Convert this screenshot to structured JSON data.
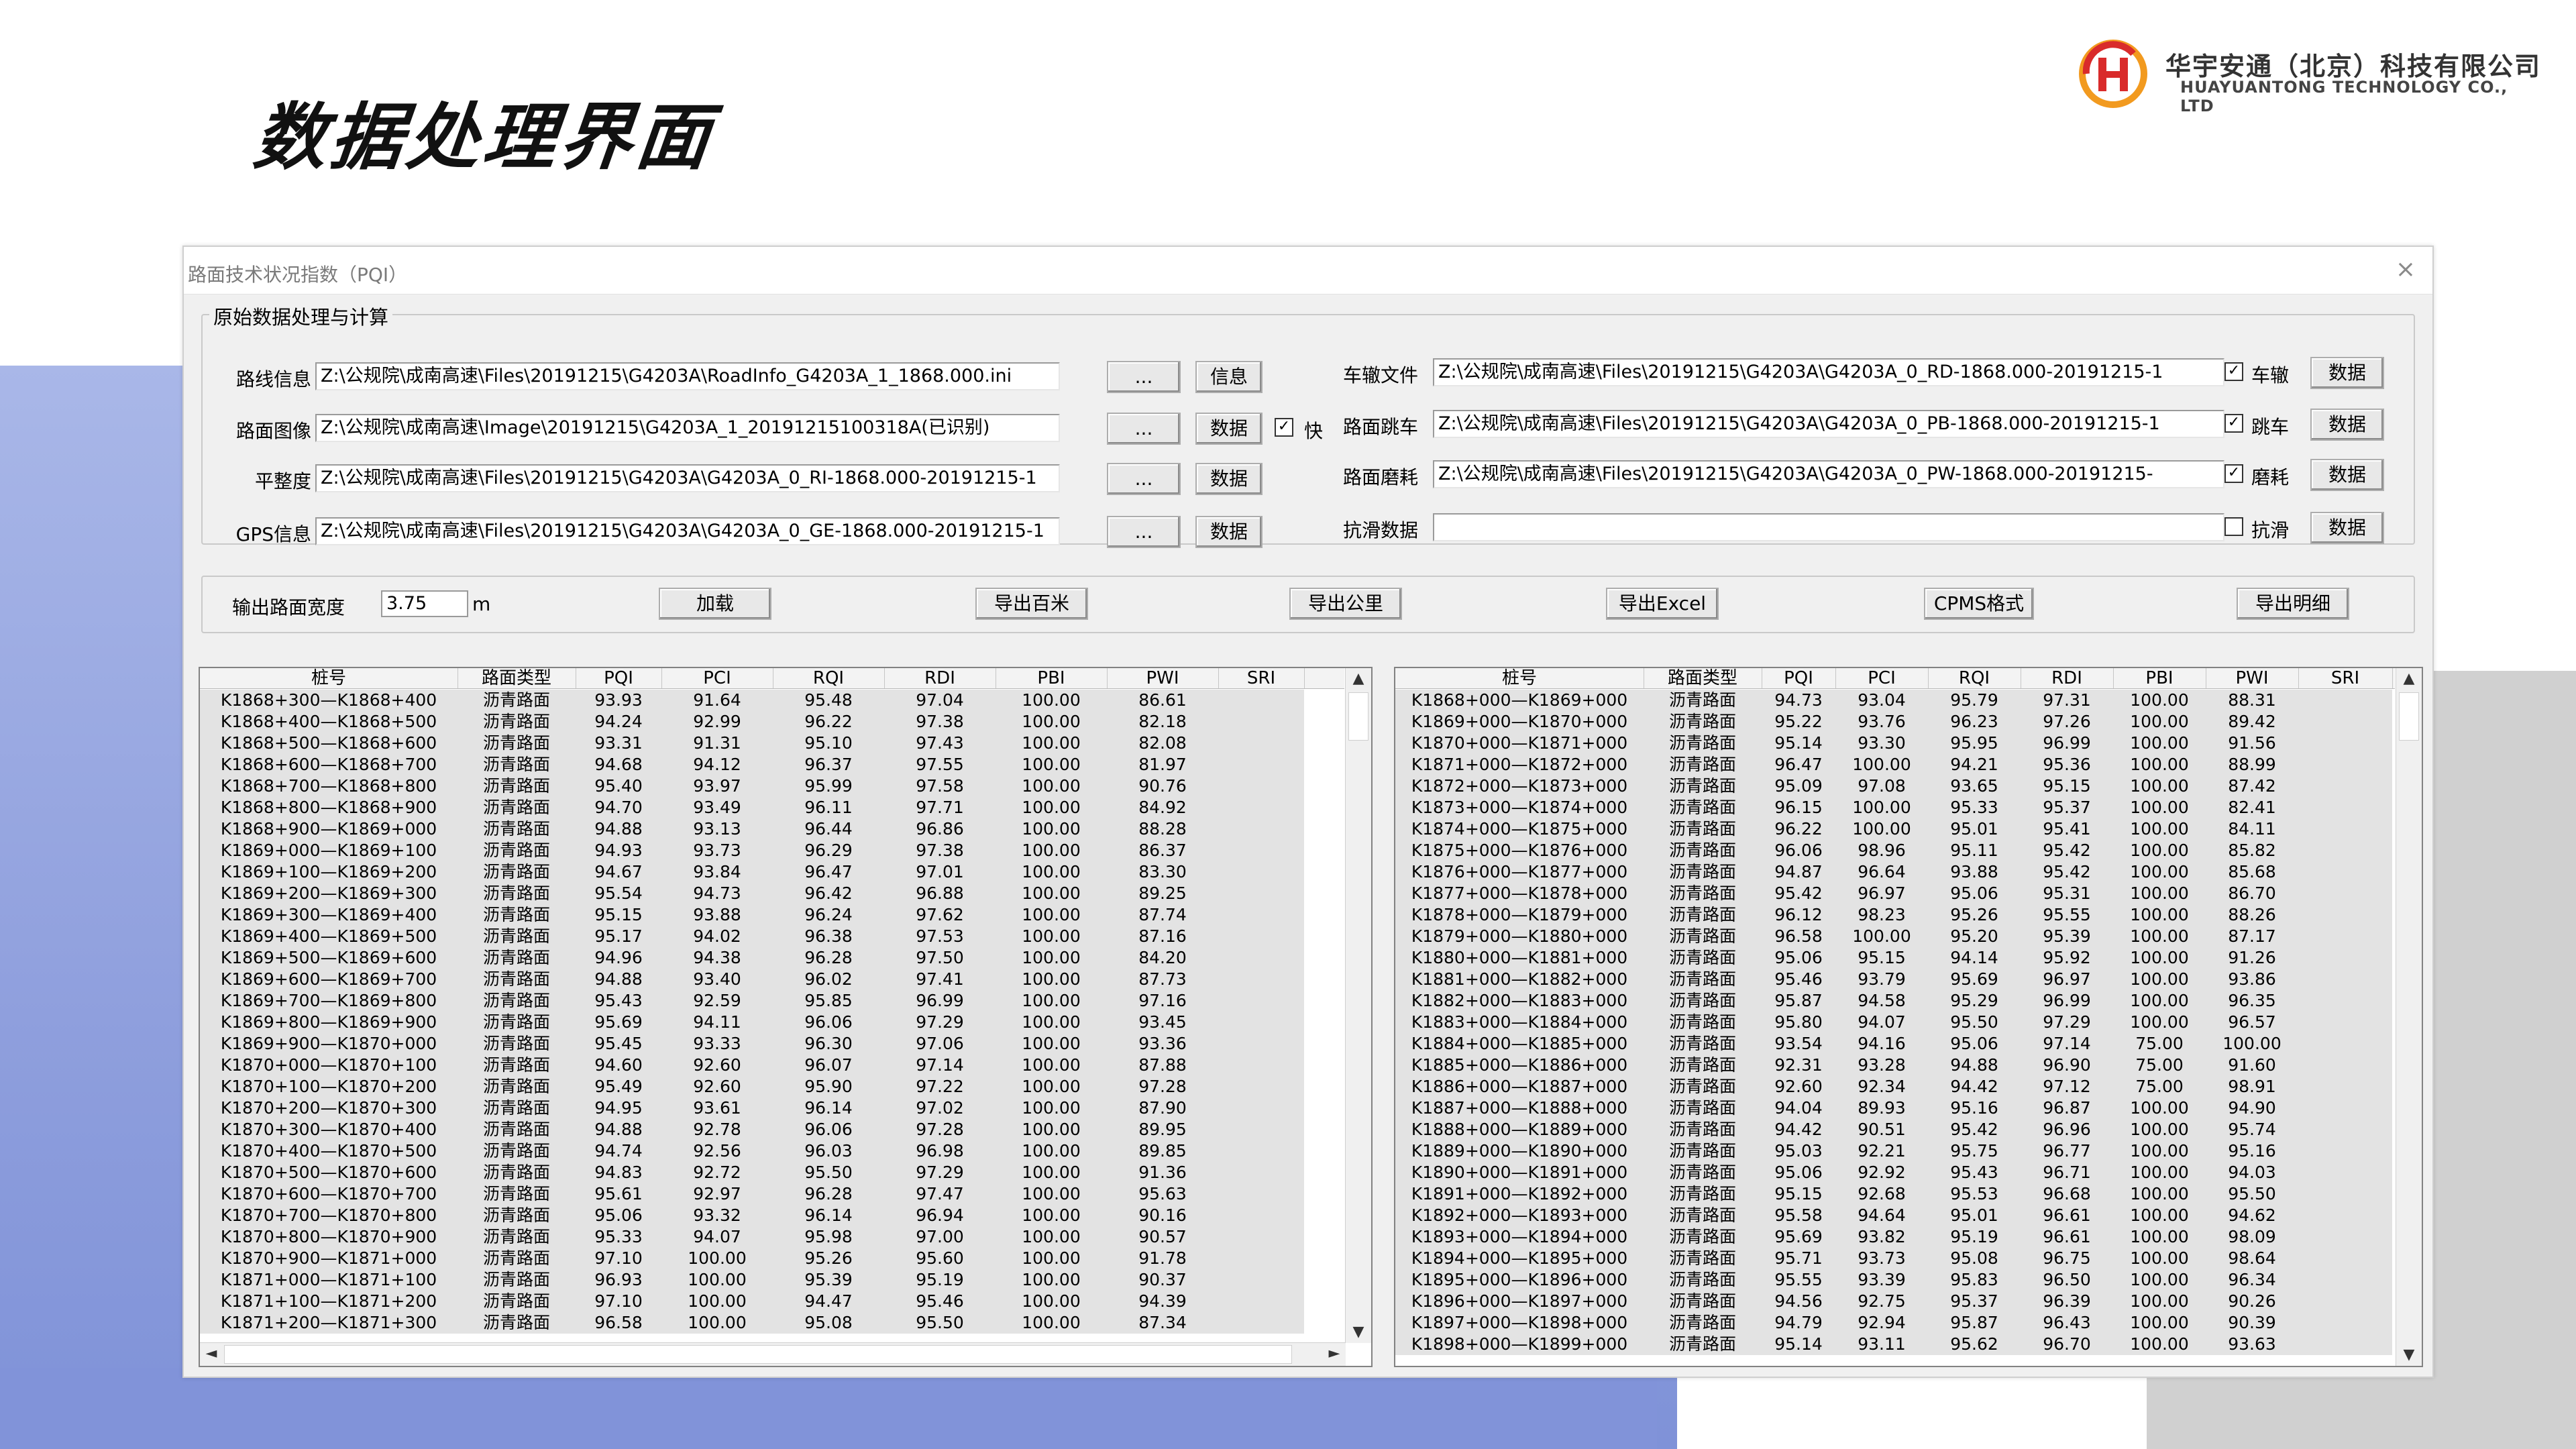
{
  "slide": {
    "title": "数据处理界面",
    "logo_cn": "华宇安通（北京）科技有限公司",
    "logo_en": "HUAYUANTONG TECHNOLOGY CO., LTD",
    "accent_red": "#d92b2b",
    "accent_orange": "#f29a1f"
  },
  "window": {
    "title": "路面技术状况指数（PQI）",
    "close_icon": "×",
    "group_title": "原始数据处理与计算"
  },
  "left_fields": [
    {
      "label": "路线信息",
      "value": "Z:\\公规院\\成南高速\\Files\\20191215\\G4203A\\RoadInfo_G4203A_1_1868.000.ini",
      "browse": "...",
      "action": "信息"
    },
    {
      "label": "路面图像",
      "value": "Z:\\公规院\\成南高速\\Image\\20191215\\G4203A_1_20191215100318A(已识别)",
      "browse": "...",
      "action": "数据",
      "check_label": "快",
      "checked": "✓"
    },
    {
      "label": "平整度",
      "value": "Z:\\公规院\\成南高速\\Files\\20191215\\G4203A\\G4203A_0_RI-1868.000-20191215-1",
      "browse": "...",
      "action": "数据"
    },
    {
      "label": "GPS信息",
      "value": "Z:\\公规院\\成南高速\\Files\\20191215\\G4203A\\G4203A_0_GE-1868.000-20191215-1",
      "browse": "...",
      "action": "数据"
    }
  ],
  "right_fields": [
    {
      "label": "车辙文件",
      "value": "Z:\\公规院\\成南高速\\Files\\20191215\\G4203A\\G4203A_0_RD-1868.000-20191215-1",
      "check_label": "车辙",
      "checked": "✓",
      "action": "数据"
    },
    {
      "label": "路面跳车",
      "value": "Z:\\公规院\\成南高速\\Files\\20191215\\G4203A\\G4203A_0_PB-1868.000-20191215-1",
      "check_label": "跳车",
      "checked": "✓",
      "action": "数据"
    },
    {
      "label": "路面磨耗",
      "value": "Z:\\公规院\\成南高速\\Files\\20191215\\G4203A\\G4203A_0_PW-1868.000-20191215-",
      "check_label": "磨耗",
      "checked": "✓",
      "action": "数据"
    },
    {
      "label": "抗滑数据",
      "value": "",
      "check_label": "抗滑",
      "checked": "",
      "action": "数据"
    }
  ],
  "output": {
    "width_label": "输出路面宽度",
    "width_value": "3.75",
    "unit": "m",
    "buttons": [
      "加载",
      "导出百米",
      "导出公里",
      "导出Excel",
      "CPMS格式",
      "导出明细"
    ]
  },
  "columns": [
    "桩号",
    "路面类型",
    "PQI",
    "PCI",
    "RQI",
    "RDI",
    "PBI",
    "PWI",
    "SRI"
  ],
  "left_table": [
    [
      "K1868+300—K1868+400",
      "沥青路面",
      "93.93",
      "91.64",
      "95.48",
      "97.04",
      "100.00",
      "86.61",
      ""
    ],
    [
      "K1868+400—K1868+500",
      "沥青路面",
      "94.24",
      "92.99",
      "96.22",
      "97.38",
      "100.00",
      "82.18",
      ""
    ],
    [
      "K1868+500—K1868+600",
      "沥青路面",
      "93.31",
      "91.31",
      "95.10",
      "97.43",
      "100.00",
      "82.08",
      ""
    ],
    [
      "K1868+600—K1868+700",
      "沥青路面",
      "94.68",
      "94.12",
      "96.37",
      "97.55",
      "100.00",
      "81.97",
      ""
    ],
    [
      "K1868+700—K1868+800",
      "沥青路面",
      "95.40",
      "93.97",
      "95.99",
      "97.58",
      "100.00",
      "90.76",
      ""
    ],
    [
      "K1868+800—K1868+900",
      "沥青路面",
      "94.70",
      "93.49",
      "96.11",
      "97.71",
      "100.00",
      "84.92",
      ""
    ],
    [
      "K1868+900—K1869+000",
      "沥青路面",
      "94.88",
      "93.13",
      "96.44",
      "96.86",
      "100.00",
      "88.28",
      ""
    ],
    [
      "K1869+000—K1869+100",
      "沥青路面",
      "94.93",
      "93.73",
      "96.29",
      "97.38",
      "100.00",
      "86.37",
      ""
    ],
    [
      "K1869+100—K1869+200",
      "沥青路面",
      "94.67",
      "93.84",
      "96.47",
      "97.01",
      "100.00",
      "83.30",
      ""
    ],
    [
      "K1869+200—K1869+300",
      "沥青路面",
      "95.54",
      "94.73",
      "96.42",
      "96.88",
      "100.00",
      "89.25",
      ""
    ],
    [
      "K1869+300—K1869+400",
      "沥青路面",
      "95.15",
      "93.88",
      "96.24",
      "97.62",
      "100.00",
      "87.74",
      ""
    ],
    [
      "K1869+400—K1869+500",
      "沥青路面",
      "95.17",
      "94.02",
      "96.38",
      "97.53",
      "100.00",
      "87.16",
      ""
    ],
    [
      "K1869+500—K1869+600",
      "沥青路面",
      "94.96",
      "94.38",
      "96.28",
      "97.50",
      "100.00",
      "84.20",
      ""
    ],
    [
      "K1869+600—K1869+700",
      "沥青路面",
      "94.88",
      "93.40",
      "96.02",
      "97.41",
      "100.00",
      "87.73",
      ""
    ],
    [
      "K1869+700—K1869+800",
      "沥青路面",
      "95.43",
      "92.59",
      "95.85",
      "96.99",
      "100.00",
      "97.16",
      ""
    ],
    [
      "K1869+800—K1869+900",
      "沥青路面",
      "95.69",
      "94.11",
      "96.06",
      "97.29",
      "100.00",
      "93.45",
      ""
    ],
    [
      "K1869+900—K1870+000",
      "沥青路面",
      "95.45",
      "93.33",
      "96.30",
      "97.06",
      "100.00",
      "93.36",
      ""
    ],
    [
      "K1870+000—K1870+100",
      "沥青路面",
      "94.60",
      "92.60",
      "96.07",
      "97.14",
      "100.00",
      "87.88",
      ""
    ],
    [
      "K1870+100—K1870+200",
      "沥青路面",
      "95.49",
      "92.60",
      "95.90",
      "97.22",
      "100.00",
      "97.28",
      ""
    ],
    [
      "K1870+200—K1870+300",
      "沥青路面",
      "94.95",
      "93.61",
      "96.14",
      "97.02",
      "100.00",
      "87.90",
      ""
    ],
    [
      "K1870+300—K1870+400",
      "沥青路面",
      "94.88",
      "92.78",
      "96.06",
      "97.28",
      "100.00",
      "89.95",
      ""
    ],
    [
      "K1870+400—K1870+500",
      "沥青路面",
      "94.74",
      "92.56",
      "96.03",
      "96.98",
      "100.00",
      "89.85",
      ""
    ],
    [
      "K1870+500—K1870+600",
      "沥青路面",
      "94.83",
      "92.72",
      "95.50",
      "97.29",
      "100.00",
      "91.36",
      ""
    ],
    [
      "K1870+600—K1870+700",
      "沥青路面",
      "95.61",
      "92.97",
      "96.28",
      "97.47",
      "100.00",
      "95.63",
      ""
    ],
    [
      "K1870+700—K1870+800",
      "沥青路面",
      "95.06",
      "93.32",
      "96.14",
      "96.94",
      "100.00",
      "90.16",
      ""
    ],
    [
      "K1870+800—K1870+900",
      "沥青路面",
      "95.33",
      "94.07",
      "95.98",
      "97.00",
      "100.00",
      "90.57",
      ""
    ],
    [
      "K1870+900—K1871+000",
      "沥青路面",
      "97.10",
      "100.00",
      "95.26",
      "95.60",
      "100.00",
      "91.78",
      ""
    ],
    [
      "K1871+000—K1871+100",
      "沥青路面",
      "96.93",
      "100.00",
      "95.39",
      "95.19",
      "100.00",
      "90.37",
      ""
    ],
    [
      "K1871+100—K1871+200",
      "沥青路面",
      "97.10",
      "100.00",
      "94.47",
      "95.46",
      "100.00",
      "94.39",
      ""
    ],
    [
      "K1871+200—K1871+300",
      "沥青路面",
      "96.58",
      "100.00",
      "95.08",
      "95.50",
      "100.00",
      "87.34",
      ""
    ]
  ],
  "right_table": [
    [
      "K1868+000—K1869+000",
      "沥青路面",
      "94.73",
      "93.04",
      "95.79",
      "97.31",
      "100.00",
      "88.31",
      ""
    ],
    [
      "K1869+000—K1870+000",
      "沥青路面",
      "95.22",
      "93.76",
      "96.23",
      "97.26",
      "100.00",
      "89.42",
      ""
    ],
    [
      "K1870+000—K1871+000",
      "沥青路面",
      "95.14",
      "93.30",
      "95.95",
      "96.99",
      "100.00",
      "91.56",
      ""
    ],
    [
      "K1871+000—K1872+000",
      "沥青路面",
      "96.47",
      "100.00",
      "94.21",
      "95.36",
      "100.00",
      "88.99",
      ""
    ],
    [
      "K1872+000—K1873+000",
      "沥青路面",
      "95.09",
      "97.08",
      "93.65",
      "95.15",
      "100.00",
      "87.42",
      ""
    ],
    [
      "K1873+000—K1874+000",
      "沥青路面",
      "96.15",
      "100.00",
      "95.33",
      "95.37",
      "100.00",
      "82.41",
      ""
    ],
    [
      "K1874+000—K1875+000",
      "沥青路面",
      "96.22",
      "100.00",
      "95.01",
      "95.41",
      "100.00",
      "84.11",
      ""
    ],
    [
      "K1875+000—K1876+000",
      "沥青路面",
      "96.06",
      "98.96",
      "95.11",
      "95.42",
      "100.00",
      "85.82",
      ""
    ],
    [
      "K1876+000—K1877+000",
      "沥青路面",
      "94.87",
      "96.64",
      "93.88",
      "95.42",
      "100.00",
      "85.68",
      ""
    ],
    [
      "K1877+000—K1878+000",
      "沥青路面",
      "95.42",
      "96.97",
      "95.06",
      "95.31",
      "100.00",
      "86.70",
      ""
    ],
    [
      "K1878+000—K1879+000",
      "沥青路面",
      "96.12",
      "98.23",
      "95.26",
      "95.55",
      "100.00",
      "88.26",
      ""
    ],
    [
      "K1879+000—K1880+000",
      "沥青路面",
      "96.58",
      "100.00",
      "95.20",
      "95.39",
      "100.00",
      "87.17",
      ""
    ],
    [
      "K1880+000—K1881+000",
      "沥青路面",
      "95.06",
      "95.15",
      "94.14",
      "95.92",
      "100.00",
      "91.26",
      ""
    ],
    [
      "K1881+000—K1882+000",
      "沥青路面",
      "95.46",
      "93.79",
      "95.69",
      "96.97",
      "100.00",
      "93.86",
      ""
    ],
    [
      "K1882+000—K1883+000",
      "沥青路面",
      "95.87",
      "94.58",
      "95.29",
      "96.99",
      "100.00",
      "96.35",
      ""
    ],
    [
      "K1883+000—K1884+000",
      "沥青路面",
      "95.80",
      "94.07",
      "95.50",
      "97.29",
      "100.00",
      "96.57",
      ""
    ],
    [
      "K1884+000—K1885+000",
      "沥青路面",
      "93.54",
      "94.16",
      "95.06",
      "97.14",
      "75.00",
      "100.00",
      ""
    ],
    [
      "K1885+000—K1886+000",
      "沥青路面",
      "92.31",
      "93.28",
      "94.88",
      "96.90",
      "75.00",
      "91.60",
      ""
    ],
    [
      "K1886+000—K1887+000",
      "沥青路面",
      "92.60",
      "92.34",
      "94.42",
      "97.12",
      "75.00",
      "98.91",
      ""
    ],
    [
      "K1887+000—K1888+000",
      "沥青路面",
      "94.04",
      "89.93",
      "95.16",
      "96.87",
      "100.00",
      "94.90",
      ""
    ],
    [
      "K1888+000—K1889+000",
      "沥青路面",
      "94.42",
      "90.51",
      "95.42",
      "96.96",
      "100.00",
      "95.74",
      ""
    ],
    [
      "K1889+000—K1890+000",
      "沥青路面",
      "95.03",
      "92.21",
      "95.75",
      "96.77",
      "100.00",
      "95.16",
      ""
    ],
    [
      "K1890+000—K1891+000",
      "沥青路面",
      "95.06",
      "92.92",
      "95.43",
      "96.71",
      "100.00",
      "94.03",
      ""
    ],
    [
      "K1891+000—K1892+000",
      "沥青路面",
      "95.15",
      "92.68",
      "95.53",
      "96.68",
      "100.00",
      "95.50",
      ""
    ],
    [
      "K1892+000—K1893+000",
      "沥青路面",
      "95.58",
      "94.64",
      "95.01",
      "96.61",
      "100.00",
      "94.62",
      ""
    ],
    [
      "K1893+000—K1894+000",
      "沥青路面",
      "95.69",
      "93.82",
      "95.19",
      "96.61",
      "100.00",
      "98.09",
      ""
    ],
    [
      "K1894+000—K1895+000",
      "沥青路面",
      "95.71",
      "93.73",
      "95.08",
      "96.75",
      "100.00",
      "98.64",
      ""
    ],
    [
      "K1895+000—K1896+000",
      "沥青路面",
      "95.55",
      "93.39",
      "95.83",
      "96.50",
      "100.00",
      "96.34",
      ""
    ],
    [
      "K1896+000—K1897+000",
      "沥青路面",
      "94.56",
      "92.75",
      "95.37",
      "96.39",
      "100.00",
      "90.26",
      ""
    ],
    [
      "K1897+000—K1898+000",
      "沥青路面",
      "94.79",
      "92.94",
      "95.87",
      "96.43",
      "100.00",
      "90.39",
      ""
    ],
    [
      "K1898+000—K1899+000",
      "沥青路面",
      "95.14",
      "93.11",
      "95.62",
      "96.70",
      "100.00",
      "93.63",
      ""
    ]
  ]
}
